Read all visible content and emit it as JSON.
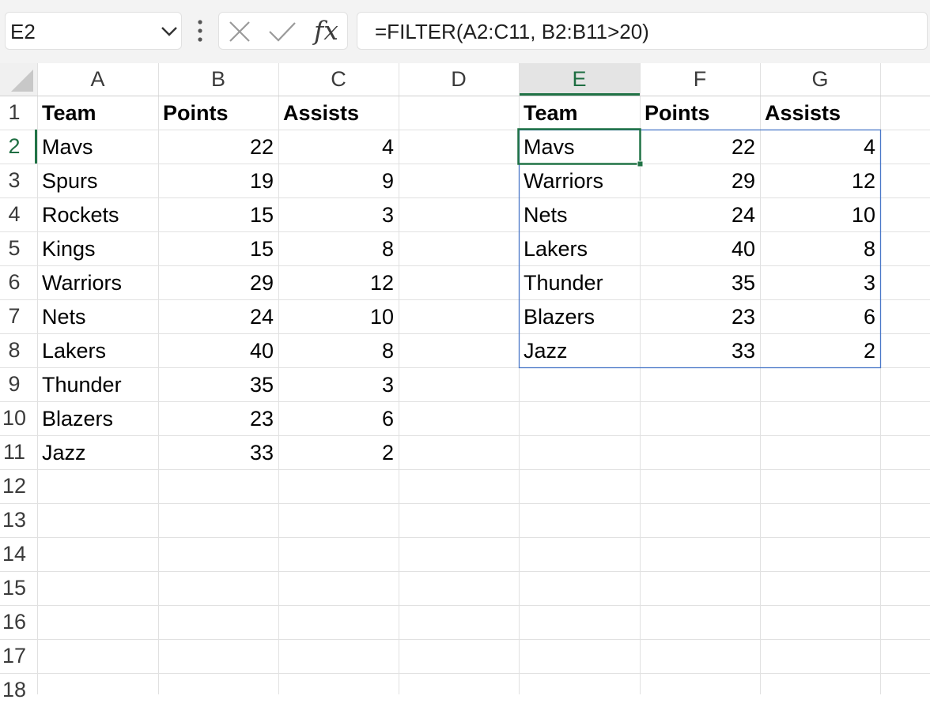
{
  "name_box": {
    "value": "E2"
  },
  "formula_bar": {
    "fx_label": "fx",
    "formula": "=FILTER(A2:C11, B2:B11>20)"
  },
  "icons": {
    "name_box_dropdown": "chevron-down-icon",
    "more": "vertical-ellipsis-icon",
    "cancel": "x-icon",
    "enter": "checkmark-icon"
  },
  "colors": {
    "active_header": "#1e6e42",
    "selection_border": "#217346",
    "spill_border": "#4a78c8",
    "grid_line": "#e1e1e1"
  },
  "sheet": {
    "active_cell": "E2",
    "spill_range": "E2:G8",
    "columns": [
      "A",
      "B",
      "C",
      "D",
      "E",
      "F",
      "G"
    ],
    "active_column": "E",
    "rows": [
      "1",
      "2",
      "3",
      "4",
      "5",
      "6",
      "7",
      "8",
      "9",
      "10",
      "11",
      "12",
      "13",
      "14",
      "15",
      "16",
      "17",
      "18"
    ],
    "active_row": "2",
    "source_table": {
      "headers": [
        "Team",
        "Points",
        "Assists"
      ],
      "rows": [
        [
          "Mavs",
          "22",
          "4"
        ],
        [
          "Spurs",
          "19",
          "9"
        ],
        [
          "Rockets",
          "15",
          "3"
        ],
        [
          "Kings",
          "15",
          "8"
        ],
        [
          "Warriors",
          "29",
          "12"
        ],
        [
          "Nets",
          "24",
          "10"
        ],
        [
          "Lakers",
          "40",
          "8"
        ],
        [
          "Thunder",
          "35",
          "3"
        ],
        [
          "Blazers",
          "23",
          "6"
        ],
        [
          "Jazz",
          "33",
          "2"
        ]
      ]
    },
    "filtered_table": {
      "headers": [
        "Team",
        "Points",
        "Assists"
      ],
      "rows": [
        [
          "Mavs",
          "22",
          "4"
        ],
        [
          "Warriors",
          "29",
          "12"
        ],
        [
          "Nets",
          "24",
          "10"
        ],
        [
          "Lakers",
          "40",
          "8"
        ],
        [
          "Thunder",
          "35",
          "3"
        ],
        [
          "Blazers",
          "23",
          "6"
        ],
        [
          "Jazz",
          "33",
          "2"
        ]
      ]
    }
  }
}
